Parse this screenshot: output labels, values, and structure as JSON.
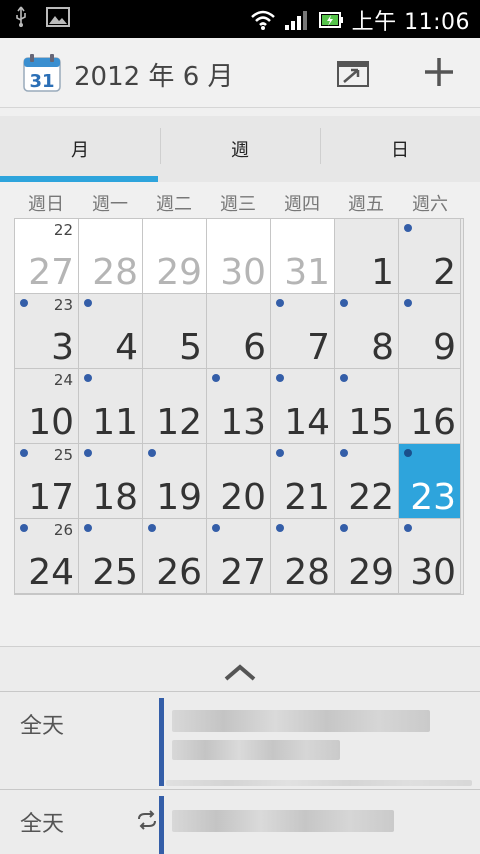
{
  "status_bar": {
    "time": "上午 11:06",
    "icons": [
      "usb-icon",
      "image-icon",
      "wifi-icon",
      "signal-icon",
      "battery-charging-icon"
    ]
  },
  "action_bar": {
    "app_icon_label": "31",
    "title": "2012 年 6 月",
    "icons": [
      "today-icon",
      "add-icon"
    ]
  },
  "tabs": [
    {
      "label": "月",
      "selected": true
    },
    {
      "label": "週",
      "selected": false
    },
    {
      "label": "日",
      "selected": false
    }
  ],
  "weekdays": [
    "週日",
    "週一",
    "週二",
    "週三",
    "週四",
    "週五",
    "週六"
  ],
  "calendar": {
    "weeks": [
      {
        "week_no": "22",
        "days": [
          "27",
          "28",
          "29",
          "30",
          "31",
          "1",
          "2"
        ]
      },
      {
        "week_no": "23",
        "days": [
          "3",
          "4",
          "5",
          "6",
          "7",
          "8",
          "9"
        ]
      },
      {
        "week_no": "24",
        "days": [
          "10",
          "11",
          "12",
          "13",
          "14",
          "15",
          "16"
        ]
      },
      {
        "week_no": "25",
        "days": [
          "17",
          "18",
          "19",
          "20",
          "21",
          "22",
          "23"
        ]
      },
      {
        "week_no": "26",
        "days": [
          "24",
          "25",
          "26",
          "27",
          "28",
          "29",
          "30"
        ]
      }
    ],
    "prev_month_cells": [
      [
        0,
        0
      ],
      [
        0,
        1
      ],
      [
        0,
        2
      ],
      [
        0,
        3
      ],
      [
        0,
        4
      ]
    ],
    "selected_cell": [
      3,
      6
    ],
    "event_dots": [
      [
        0,
        6
      ],
      [
        1,
        0
      ],
      [
        1,
        1
      ],
      [
        1,
        4
      ],
      [
        1,
        5
      ],
      [
        1,
        6
      ],
      [
        2,
        1
      ],
      [
        2,
        3
      ],
      [
        2,
        4
      ],
      [
        2,
        5
      ],
      [
        3,
        0
      ],
      [
        3,
        1
      ],
      [
        3,
        2
      ],
      [
        3,
        4
      ],
      [
        3,
        5
      ],
      [
        3,
        6
      ],
      [
        4,
        0
      ],
      [
        4,
        1
      ],
      [
        4,
        2
      ],
      [
        4,
        3
      ],
      [
        4,
        4
      ],
      [
        4,
        5
      ],
      [
        4,
        6
      ]
    ]
  },
  "agenda": {
    "events": [
      {
        "label": "全天",
        "repeat": false
      },
      {
        "label": "全天",
        "repeat": true
      }
    ]
  },
  "colors": {
    "accent": "#2ea4dc",
    "event_dot": "#345ea8",
    "event_bar": "#345ea8"
  }
}
